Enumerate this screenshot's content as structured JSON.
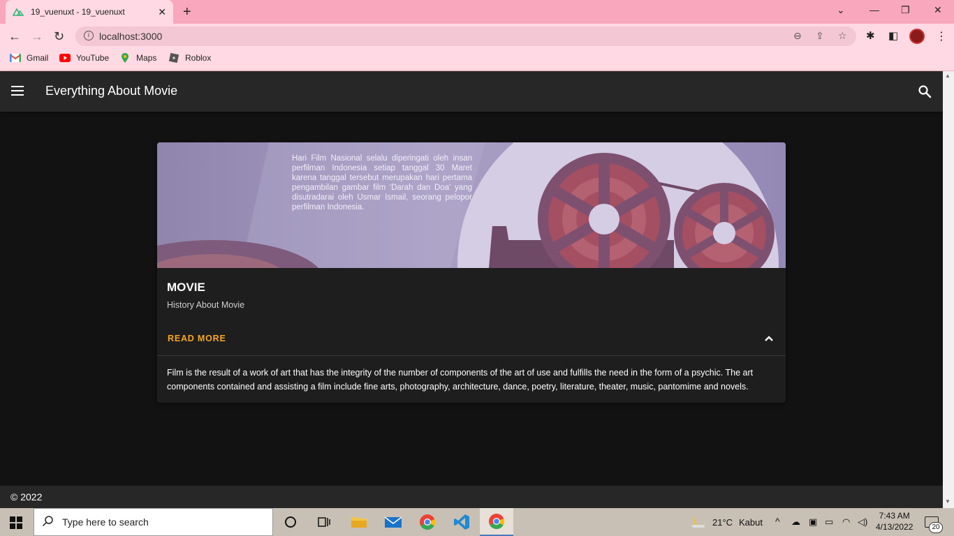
{
  "browser": {
    "tab_title": "19_vuenuxt - 19_vuenuxt",
    "url": "localhost:3000",
    "bookmarks": [
      {
        "label": "Gmail",
        "icon": "gmail-icon"
      },
      {
        "label": "YouTube",
        "icon": "youtube-icon"
      },
      {
        "label": "Maps",
        "icon": "maps-icon"
      },
      {
        "label": "Roblox",
        "icon": "roblox-icon"
      }
    ]
  },
  "app": {
    "title": "Everything About Movie",
    "accent": "#f5a623"
  },
  "card": {
    "image_text": "Hari Film Nasional selalu diperingati oleh insan perfilman Indonesia setiap tanggal 30 Maret karena tanggal tersebut merupakan hari pertama pengambilan gambar film 'Darah dan Doa' yang disutradarai oleh Usmar Ismail, seorang pelopor perfilman Indonesia.",
    "title": "MOVIE",
    "subtitle": "History About Movie",
    "action_label": "READ MORE",
    "body": "Film is the result of a work of art that has the integrity of the number of components of the art of use and fulfills the need in the form of a psychic. The art components contained and assisting a film include fine arts, photography, architecture, dance, poetry, literature, theater, music, pantomime and novels."
  },
  "footer": {
    "text": "© 2022"
  },
  "taskbar": {
    "search_placeholder": "Type here to search",
    "temperature": "21°C",
    "weather": "Kabut",
    "time": "7:43 AM",
    "date": "4/13/2022",
    "notification_count": "20"
  }
}
